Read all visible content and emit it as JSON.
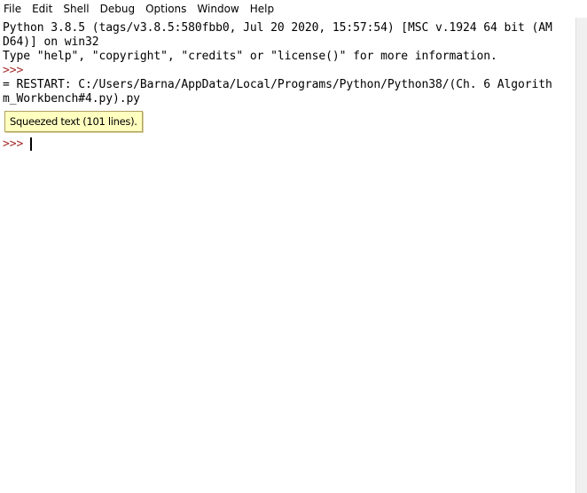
{
  "menubar": {
    "items": [
      "File",
      "Edit",
      "Shell",
      "Debug",
      "Options",
      "Window",
      "Help"
    ]
  },
  "shell": {
    "lines": [
      {
        "text": "Python 3.8.5 (tags/v3.8.5:580fbb0, Jul 20 2020, 15:57:54) [MSC v.1924 64 bit (AM",
        "kind": "output"
      },
      {
        "text": "D64)] on win32",
        "kind": "output"
      },
      {
        "text": "Type \"help\", \"copyright\", \"credits\" or \"license()\" for more information.",
        "kind": "output"
      },
      {
        "text": ">>>",
        "kind": "prompt"
      },
      {
        "text": "= RESTART: C:/Users/Barna/AppData/Local/Programs/Python/Python38/(Ch. 6 Algorith",
        "kind": "output"
      },
      {
        "text": "m_Workbench#4.py).py",
        "kind": "output"
      }
    ],
    "squeezed_label": "Squeezed text (101 lines).",
    "current_prompt": ">>>"
  },
  "colors": {
    "prompt": "#a52a2a",
    "squeezed_bg": "#ffffc0"
  }
}
